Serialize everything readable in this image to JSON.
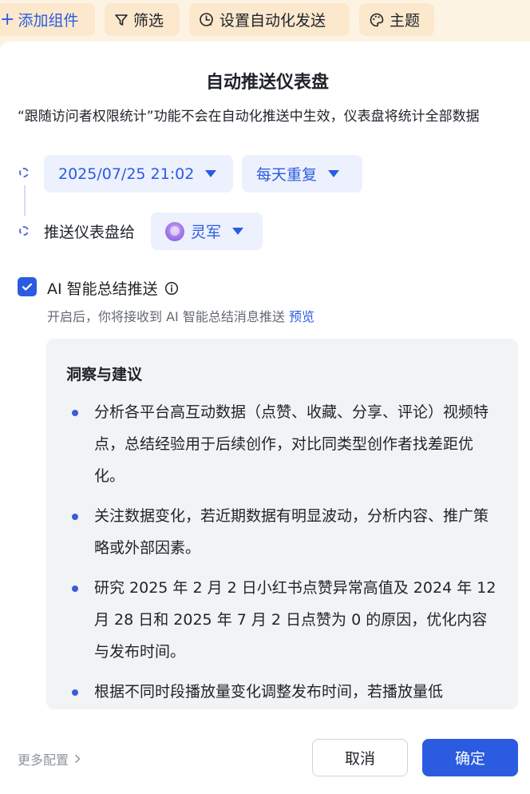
{
  "toolbar": {
    "add_component": "添加组件",
    "filter": "筛选",
    "auto_send": "设置自动化发送",
    "theme": "主题"
  },
  "dialog": {
    "title": "自动推送仪表盘",
    "notice": "“跟随访问者权限统计”功能不会在自动化推送中生效，仪表盘将统计全部数据",
    "datetime": "2025/07/25 21:02",
    "repeat": "每天重复",
    "push_to_label": "推送仪表盘给",
    "recipient": "灵军",
    "ai_summary": {
      "checked": true,
      "label": "AI 智能总结推送",
      "desc": "开启后，你将接收到 AI 智能总结消息推送",
      "preview_link": "预览"
    },
    "summary": {
      "title": "洞察与建议",
      "bullets": [
        "分析各平台高互动数据（点赞、收藏、分享、评论）视频特点，总结经验用于后续创作，对比同类型创作者找差距优化。",
        "关注数据变化，若近期数据有明显波动，分析内容、推广策略或外部因素。",
        "研究 2025 年 2 月 2 日小红书点赞异常高值及 2024 年 12 月 28 日和 2025 年 7 月 2 日点赞为 0 的原因，优化内容与发布时间。",
        "根据不同时段播放量变化调整发布时间，若播放量低"
      ]
    },
    "more_config": "更多配置",
    "cancel": "取消",
    "confirm": "确定"
  },
  "colors": {
    "accent": "#2b5be0",
    "toolbar_bg": "#fdf3e3",
    "toolbar_button_bg": "#fbe8cd",
    "chip_bg": "#edf1fe",
    "summary_bg": "#f2f3f5"
  },
  "icons": {
    "add": "plus-icon",
    "filter": "filter-icon",
    "auto_send": "clock-send-icon",
    "theme": "palette-icon",
    "info": "info-icon",
    "more": "chevron-right-icon"
  }
}
